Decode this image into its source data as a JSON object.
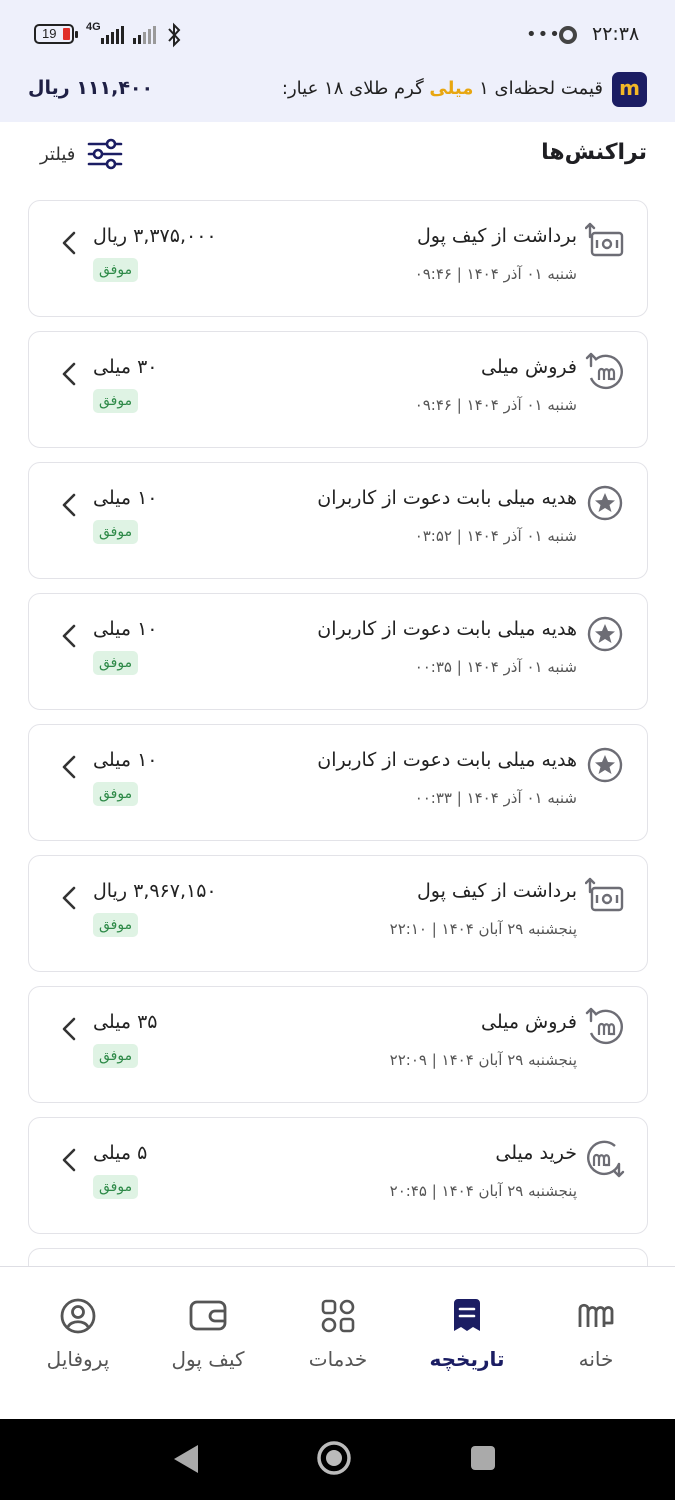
{
  "status_bar": {
    "time": "۲۲:۳۸",
    "battery": "19",
    "network": "4G",
    "more_dots": "•••"
  },
  "price_banner": {
    "logo": "m",
    "text_before": "قیمت لحظه‌ای ۱ ",
    "text_highlight": "میلی",
    "text_after": " گرم طلای ۱۸ عیار:",
    "value": "۱۱۱,۴۰۰ ریال",
    "highlight_color": "#e8a610",
    "brand_color": "#1b1d63"
  },
  "header": {
    "title": "تراکنش‌ها",
    "filter_label": "فیلتر"
  },
  "transactions": [
    {
      "icon": "wallet-withdraw-icon",
      "title": "برداشت از کیف پول",
      "date": "شنبه ۰۱ آذر ۱۴۰۴ | ۰۹:۴۶",
      "amount": "۳,۳۷۵,۰۰۰ ریال",
      "status": "موفق"
    },
    {
      "icon": "milli-sell-icon",
      "title": "فروش میلی",
      "date": "شنبه ۰۱ آذر ۱۴۰۴ | ۰۹:۴۶",
      "amount": "۳۰ میلی",
      "status": "موفق"
    },
    {
      "icon": "star-gift-icon",
      "title": "هدیه میلی بابت دعوت از کاربران",
      "date": "شنبه ۰۱ آذر ۱۴۰۴ | ۰۳:۵۲",
      "amount": "۱۰ میلی",
      "status": "موفق"
    },
    {
      "icon": "star-gift-icon",
      "title": "هدیه میلی بابت دعوت از کاربران",
      "date": "شنبه ۰۱ آذر ۱۴۰۴ | ۰۰:۳۵",
      "amount": "۱۰ میلی",
      "status": "موفق"
    },
    {
      "icon": "star-gift-icon",
      "title": "هدیه میلی بابت دعوت از کاربران",
      "date": "شنبه ۰۱ آذر ۱۴۰۴ | ۰۰:۳۳",
      "amount": "۱۰ میلی",
      "status": "موفق"
    },
    {
      "icon": "wallet-withdraw-icon",
      "title": "برداشت از کیف پول",
      "date": "پنجشنبه ۲۹ آبان ۱۴۰۴ | ۲۲:۱۰",
      "amount": "۳,۹۶۷,۱۵۰ ریال",
      "status": "موفق"
    },
    {
      "icon": "milli-sell-icon",
      "title": "فروش میلی",
      "date": "پنجشنبه ۲۹ آبان ۱۴۰۴ | ۲۲:۰۹",
      "amount": "۳۵ میلی",
      "status": "موفق"
    },
    {
      "icon": "milli-buy-icon",
      "title": "خرید میلی",
      "date": "پنجشنبه ۲۹ آبان ۱۴۰۴ | ۲۰:۴۵",
      "amount": "۵ میلی",
      "status": "موفق"
    }
  ],
  "bottom_nav": {
    "profile": "پروفایل",
    "wallet": "کیف پول",
    "services": "خدمات",
    "history": "تاریخچه",
    "home": "خانه",
    "active": "history"
  }
}
